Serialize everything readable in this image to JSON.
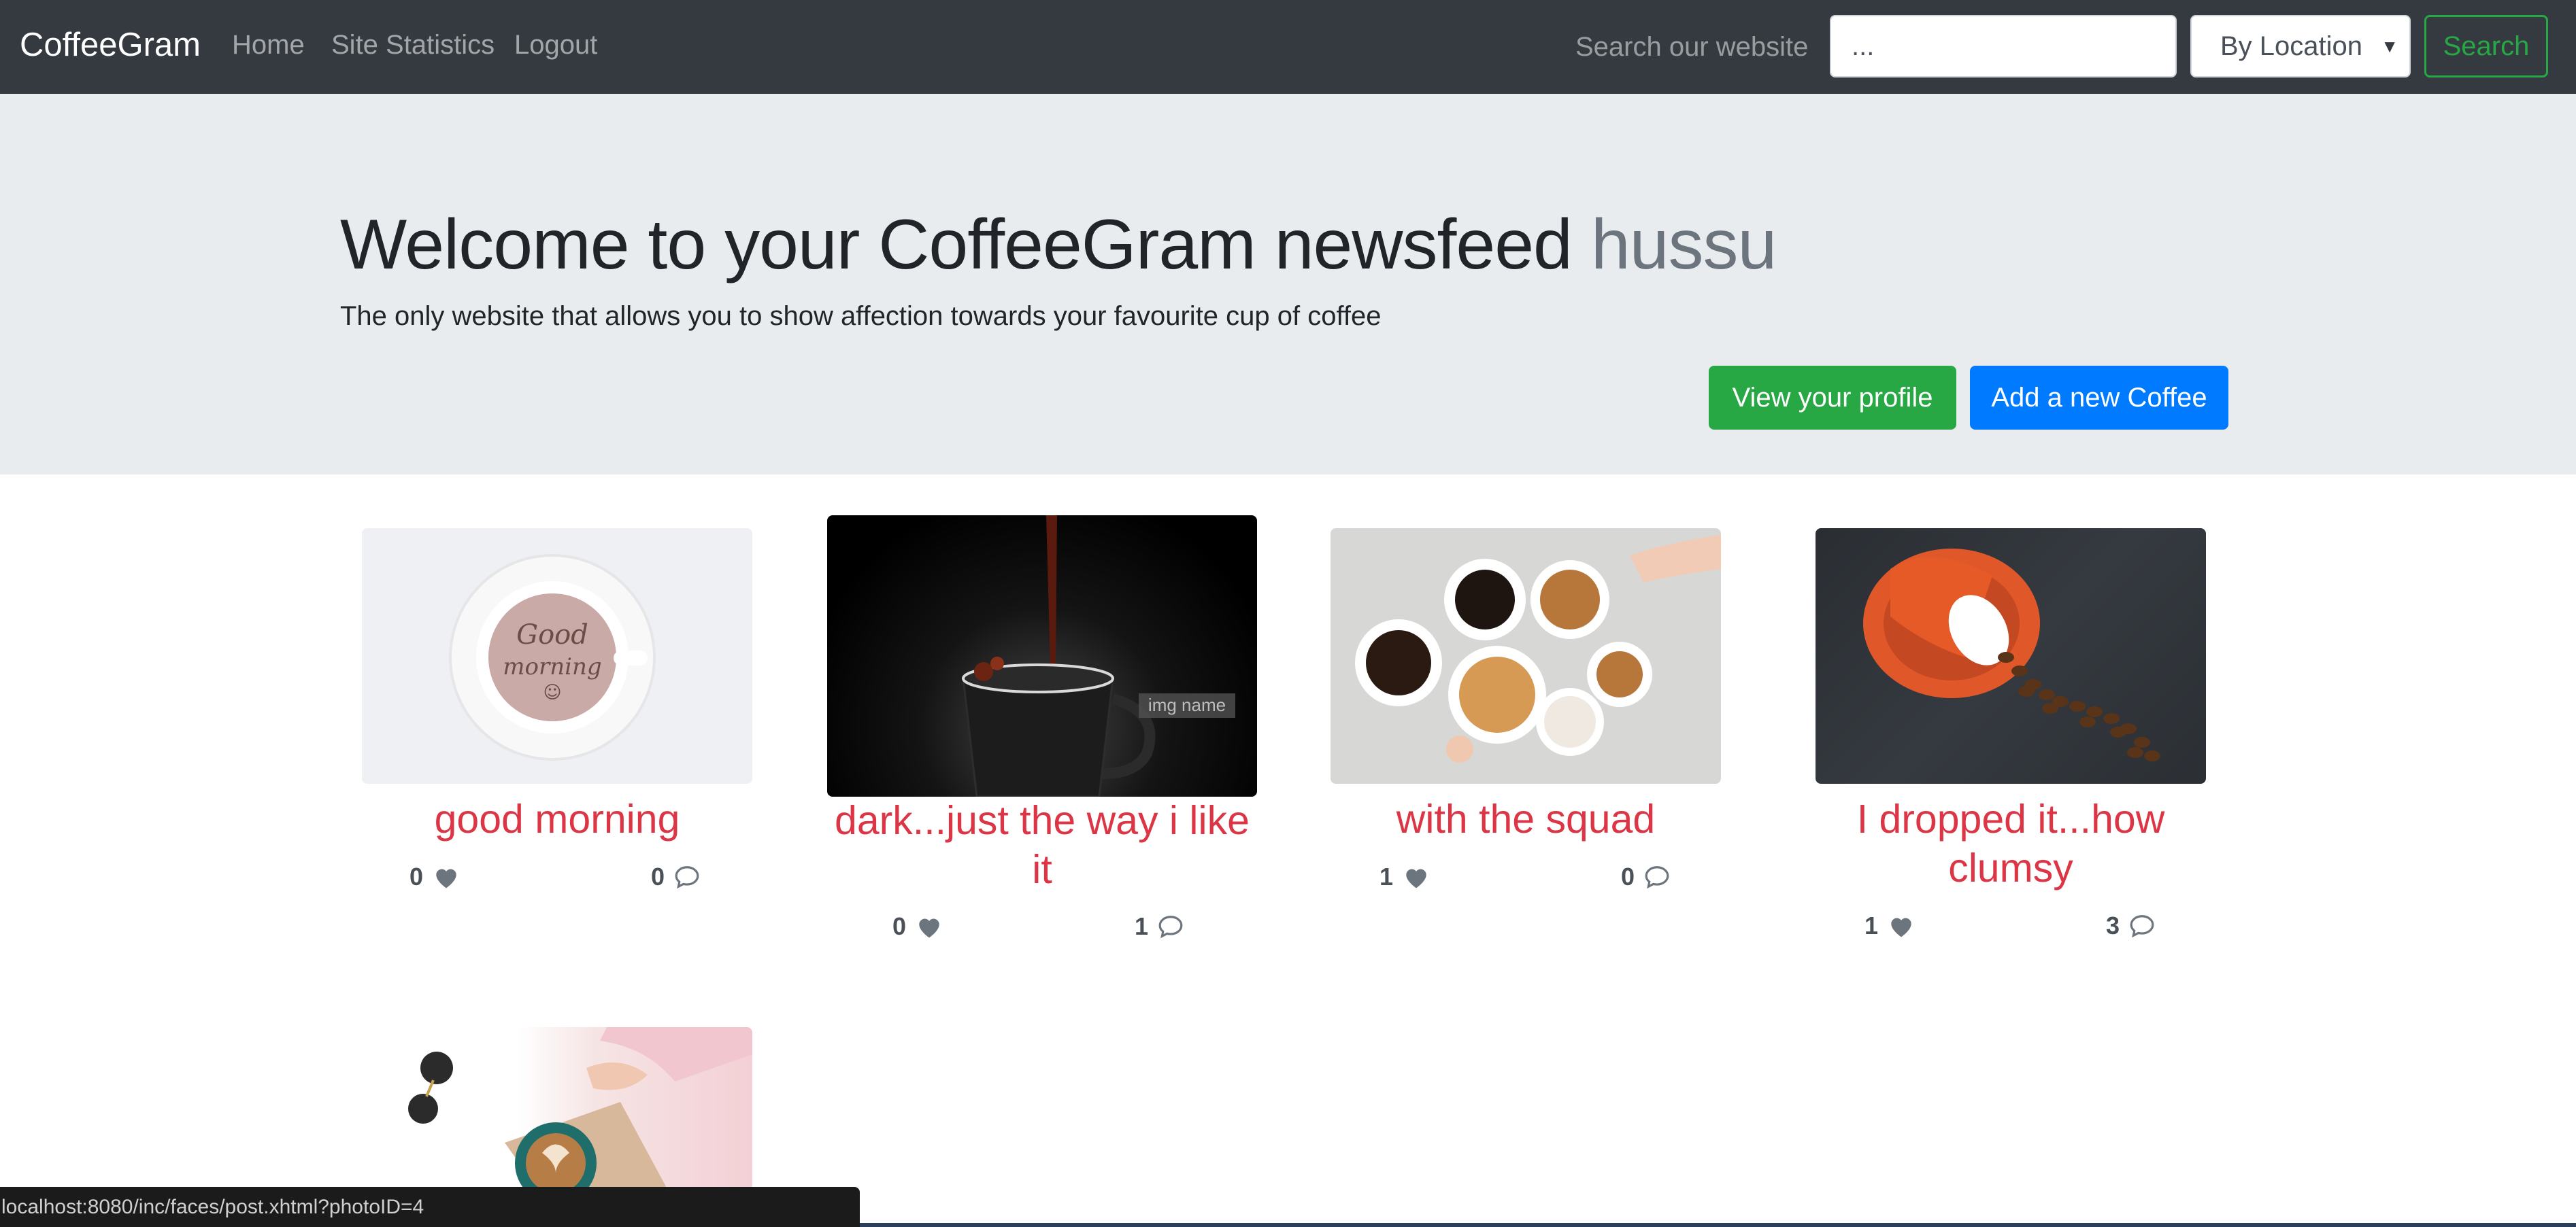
{
  "navbar": {
    "brand": "CoffeeGram",
    "links": [
      "Home",
      "Site Statistics",
      "Logout"
    ],
    "search_label": "Search our website",
    "search_value": "...",
    "filter_selected": "By Location",
    "search_button": "Search"
  },
  "jumbotron": {
    "welcome": "Welcome to your CoffeeGram newsfeed",
    "username": "hussu",
    "lead": "The only website that allows you to show affection towards your favourite cup of coffee",
    "profile_button": "View your profile",
    "add_button": "Add a new Coffee"
  },
  "posts": [
    {
      "title": "good morning",
      "likes": "0",
      "comments": "0"
    },
    {
      "title": "dark...just the way i like it",
      "likes": "0",
      "comments": "1",
      "img_alt": "img name"
    },
    {
      "title": "with the squad",
      "likes": "1",
      "comments": "0"
    },
    {
      "title": "I dropped it...how clumsy",
      "likes": "1",
      "comments": "3"
    },
    {
      "title": "",
      "likes": "",
      "comments": ""
    }
  ],
  "status_url": "localhost:8080/inc/faces/post.xhtml?photoID=4",
  "colors": {
    "navbar": "#343a40",
    "jumbotron": "#e9ecef",
    "post_title": "#dc3545",
    "green": "#28a745",
    "blue": "#007bff"
  },
  "icons": {
    "like": "heart-icon",
    "comment": "comment-icon"
  }
}
